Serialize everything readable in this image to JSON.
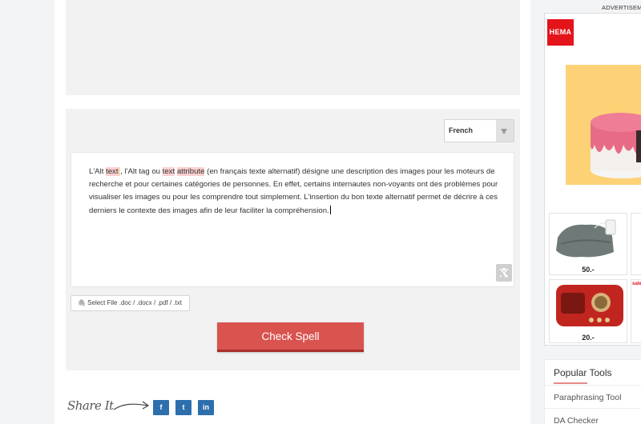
{
  "language_select": {
    "selected": "French"
  },
  "editor": {
    "segments": [
      {
        "text": "L'Alt ",
        "highlight": false
      },
      {
        "text": "text",
        "highlight": true
      },
      {
        "text": " ",
        "highlight": "orange"
      },
      {
        "text": ", l'Alt tag ou ",
        "highlight": false
      },
      {
        "text": "text",
        "highlight": true
      },
      {
        "text": " ",
        "highlight": false
      },
      {
        "text": "attribute",
        "highlight": true
      },
      {
        "text": " (en français texte alternatif) désigne une description des images pour les moteurs de recherche et pour certaines catégories de personnes. En effet, certains internautes non-voyants ont des problèmes pour visualiser les images ou pour les comprendre tout simplement. L'insertion du bon texte alternatif permet de décrire à ces derniers le contexte des images afin de leur faciliter la compréhension.",
        "highlight": false
      }
    ],
    "clear_icon": "eraser-icon"
  },
  "file_button": {
    "label": "Select File .doc / .docx / .pdf / .txt",
    "icon": "paperclip-icon"
  },
  "check_button": {
    "label": "Check Spell"
  },
  "share": {
    "label": "Share It",
    "buttons": [
      {
        "label": "f",
        "icon": "facebook-icon"
      },
      {
        "label": "t",
        "icon": "twitter-icon"
      },
      {
        "label": "in",
        "icon": "linkedin-icon"
      }
    ]
  },
  "ad": {
    "label": "ADVERTISEM",
    "brand": "HEMA",
    "products": [
      {
        "price": "50.-"
      },
      {
        "price": ""
      },
      {
        "price": "20.-"
      },
      {
        "price": "",
        "tag": "sale"
      }
    ]
  },
  "popular_tools": {
    "title": "Popular Tools",
    "links": [
      "Paraphrasing Tool",
      "DA Checker"
    ]
  },
  "colors": {
    "accent": "#d9534f",
    "highlight": "#fbd0d0",
    "social": "#2d6fad",
    "brand": "#e4141b"
  }
}
